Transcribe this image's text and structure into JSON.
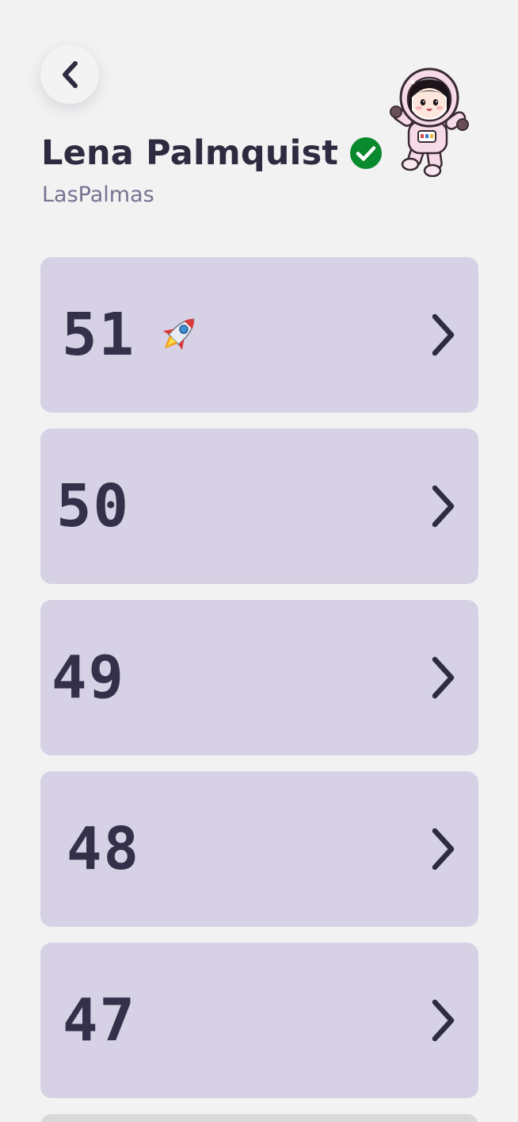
{
  "header": {
    "back_icon": "chevron-left-icon",
    "name": "Lena Palmquist",
    "verified_icon": "verified-check-icon",
    "verified_color": "#0a8a2e",
    "handle": "LasPalmas",
    "avatar_icon": "astronaut-avatar-icon"
  },
  "items": [
    {
      "number": "51",
      "badge_icon": "rocket-icon",
      "chevron_icon": "chevron-right-icon"
    },
    {
      "number": "50",
      "chevron_icon": "chevron-right-icon"
    },
    {
      "number": "49",
      "chevron_icon": "chevron-right-icon"
    },
    {
      "number": "48",
      "chevron_icon": "chevron-right-icon"
    },
    {
      "number": "47",
      "chevron_icon": "chevron-right-icon"
    }
  ],
  "colors": {
    "background": "#f2f2f3",
    "card": "#d6d1e4",
    "text": "#2e2b40",
    "subtext": "#77728f"
  }
}
